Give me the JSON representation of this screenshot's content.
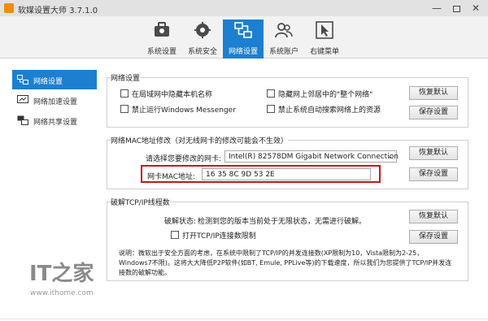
{
  "window": {
    "title": "软媒设置大师 3.7.1.0",
    "controls": {
      "minimize": "—",
      "close": "✕"
    }
  },
  "toolbar": {
    "items": [
      {
        "label": "系统设置",
        "icon": "toolbox-icon"
      },
      {
        "label": "系统安全",
        "icon": "shield-gear-icon"
      },
      {
        "label": "网络设置",
        "icon": "network-icon",
        "active": true
      },
      {
        "label": "系统账户",
        "icon": "users-icon"
      },
      {
        "label": "右键菜单",
        "icon": "cursor-icon"
      }
    ]
  },
  "sidebar": {
    "items": [
      {
        "label": "网络设置",
        "active": true
      },
      {
        "label": "网络加速设置"
      },
      {
        "label": "网络共享设置"
      }
    ]
  },
  "network_settings": {
    "title": "网络设置",
    "checkboxes": [
      "在局域网中隐藏本机名称",
      "隐藏网上邻居中的\"整个网络\"",
      "禁止运行Windows Messenger",
      "禁止系统自动搜索网络上的资源"
    ],
    "restore_label": "恢复默认",
    "save_label": "保存设置"
  },
  "mac_settings": {
    "title": "网络MAC地址修改（对无线网卡的修改可能会不生效）",
    "nic_prompt": "请选择您要修改的网卡:",
    "nic_selected": "Intel(R) 82578DM Gigabit Network Connection",
    "mac_label": "网卡MAC地址:",
    "mac_value": "16 35 8C 9D 53 2E",
    "restore_label": "恢复默认",
    "save_label": "保存设置"
  },
  "tcp_settings": {
    "title": "破解TCP/IP线程数",
    "status_label": "破解状态:",
    "status_text": "检测到您的版本当前处于无限状态，无需进行破解。",
    "checkbox_label": "打开TCP/IP连接数限制",
    "note": "说明：微软出于安全方面的考虑，在系统中限制了TCP/IP的并发连接数(XP限制为10，Vista限制为2-25，Windows7不限)。这将大大降低P2P软件(如BT, Emule, PPLive等)的下载速度，所以我们为您提供了TCP/IP并发连接数的破解功能。",
    "restore_label": "恢复默认",
    "save_label": "保存设置"
  },
  "watermark": {
    "logo": "IT之家",
    "url": "www.ithome.com"
  },
  "colors": {
    "accent": "#1c7fd0",
    "highlight_border": "#c8141e"
  }
}
